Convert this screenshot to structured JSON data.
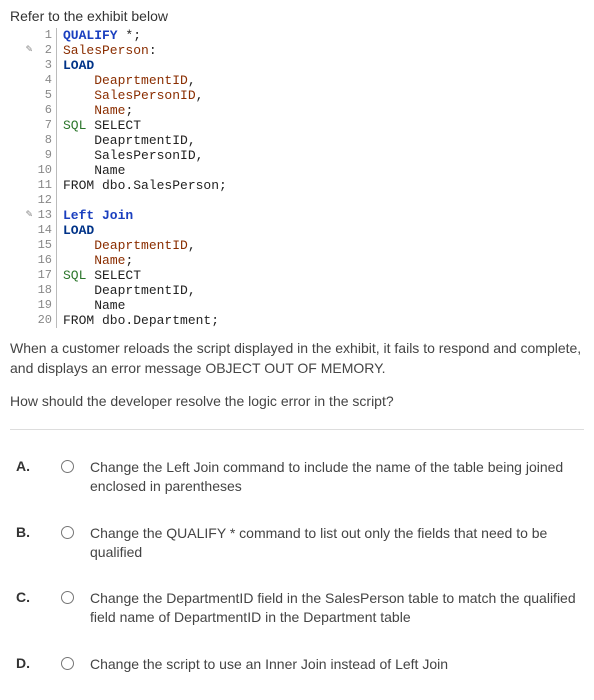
{
  "intro": "Refer to the exhibit below",
  "code_lines": [
    {
      "n": 1,
      "mark": "",
      "tokens": [
        [
          "kw-blue",
          "QUALIFY"
        ],
        [
          "txt",
          " *;"
        ]
      ]
    },
    {
      "n": 2,
      "mark": "✎",
      "tokens": [
        [
          "kw-brown",
          "SalesPerson"
        ],
        [
          "txt",
          ":"
        ]
      ]
    },
    {
      "n": 3,
      "mark": "",
      "tokens": [
        [
          "kw-navy",
          "LOAD"
        ]
      ]
    },
    {
      "n": 4,
      "mark": "",
      "tokens": [
        [
          "txt",
          "    "
        ],
        [
          "kw-brown",
          "DeaprtmentID"
        ],
        [
          "txt",
          ","
        ]
      ]
    },
    {
      "n": 5,
      "mark": "",
      "tokens": [
        [
          "txt",
          "    "
        ],
        [
          "kw-brown",
          "SalesPersonID"
        ],
        [
          "txt",
          ","
        ]
      ]
    },
    {
      "n": 6,
      "mark": "",
      "tokens": [
        [
          "txt",
          "    "
        ],
        [
          "kw-brown",
          "Name"
        ],
        [
          "txt",
          ";"
        ]
      ]
    },
    {
      "n": 7,
      "mark": "",
      "tokens": [
        [
          "kw-green",
          "SQL"
        ],
        [
          "txt",
          " SELECT"
        ]
      ]
    },
    {
      "n": 8,
      "mark": "",
      "tokens": [
        [
          "txt",
          "    DeaprtmentID,"
        ]
      ]
    },
    {
      "n": 9,
      "mark": "",
      "tokens": [
        [
          "txt",
          "    SalesPersonID,"
        ]
      ]
    },
    {
      "n": 10,
      "mark": "",
      "tokens": [
        [
          "txt",
          "    Name"
        ]
      ]
    },
    {
      "n": 11,
      "mark": "",
      "tokens": [
        [
          "txt",
          "FROM dbo.SalesPerson;"
        ]
      ]
    },
    {
      "n": 12,
      "mark": "",
      "tokens": [
        [
          "txt",
          ""
        ]
      ]
    },
    {
      "n": 13,
      "mark": "✎",
      "tokens": [
        [
          "kw-blue",
          "Left Join"
        ]
      ]
    },
    {
      "n": 14,
      "mark": "",
      "tokens": [
        [
          "kw-navy",
          "LOAD"
        ]
      ]
    },
    {
      "n": 15,
      "mark": "",
      "tokens": [
        [
          "txt",
          "    "
        ],
        [
          "kw-brown",
          "DeaprtmentID"
        ],
        [
          "txt",
          ","
        ]
      ]
    },
    {
      "n": 16,
      "mark": "",
      "tokens": [
        [
          "txt",
          "    "
        ],
        [
          "kw-brown",
          "Name"
        ],
        [
          "txt",
          ";"
        ]
      ]
    },
    {
      "n": 17,
      "mark": "",
      "tokens": [
        [
          "kw-green",
          "SQL"
        ],
        [
          "txt",
          " SELECT"
        ]
      ]
    },
    {
      "n": 18,
      "mark": "",
      "tokens": [
        [
          "txt",
          "    DeaprtmentID,"
        ]
      ]
    },
    {
      "n": 19,
      "mark": "",
      "tokens": [
        [
          "txt",
          "    Name"
        ]
      ]
    },
    {
      "n": 20,
      "mark": "",
      "tokens": [
        [
          "txt",
          "FROM dbo.Department;"
        ]
      ]
    }
  ],
  "question_p1": "When a customer reloads the script displayed in the exhibit, it fails to respond and complete, and displays an error message OBJECT OUT OF MEMORY.",
  "question_p2": "How should the developer resolve the logic error in the script?",
  "answers": [
    {
      "label": "A.",
      "text": "Change the Left Join command to include the name of the table being joined enclosed in parentheses"
    },
    {
      "label": "B.",
      "text": "Change the QUALIFY * command to list out only the fields that need to be qualified"
    },
    {
      "label": "C.",
      "text": "Change the DepartmentID field in the SalesPerson table to match the qualified field name of DepartmentID in the Department table"
    },
    {
      "label": "D.",
      "text": "Change the script to use an Inner Join instead of Left Join"
    }
  ]
}
